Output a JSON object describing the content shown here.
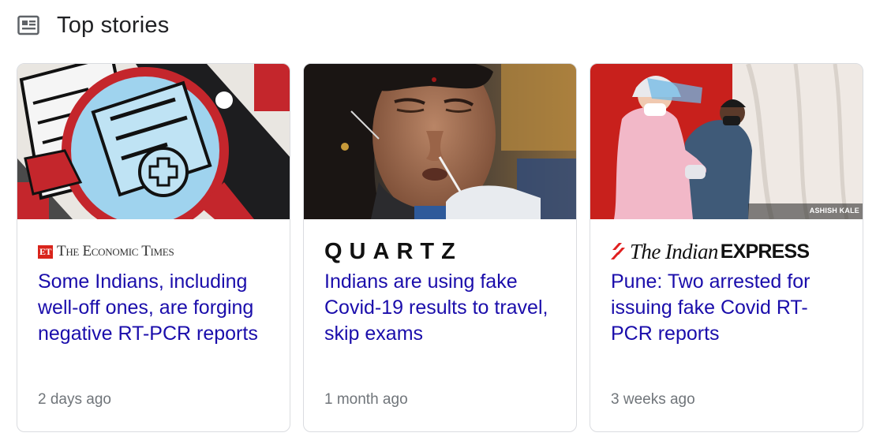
{
  "header": {
    "title": "Top stories",
    "icon": "news-icon"
  },
  "stories": [
    {
      "source": "The Economic Times",
      "source_badge": "ET",
      "source_name_display": "The Economic Times",
      "headline": "Some Indians, including well-off ones, are forging negative RT-PCR reports",
      "time": "2 days ago",
      "image": "illustration-magnifier-document"
    },
    {
      "source": "Quartz",
      "source_name_display": "QUARTZ",
      "headline": "Indians are using fake Covid-19 results to travel, skip exams",
      "time": "1 month ago",
      "image": "photo-nasal-swab-test"
    },
    {
      "source": "The Indian Express",
      "source_the": "The Indian",
      "source_express": "EXPRESS",
      "headline": "Pune: Two arrested for issuing fake Covid RT-PCR reports",
      "time": "3 weeks ago",
      "image": "photo-health-worker-testing",
      "image_credit": "ASHISH KALE"
    }
  ],
  "colors": {
    "headline_link": "#1a0dab",
    "meta_text": "#70757a",
    "card_border": "#dadce0",
    "et_red": "#d9241b",
    "ie_red": "#e02020"
  }
}
